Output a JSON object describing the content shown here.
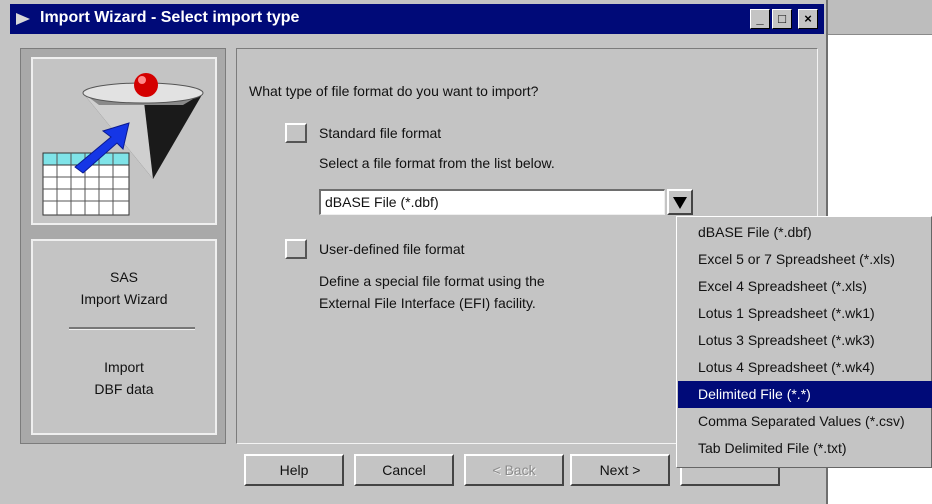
{
  "window": {
    "title": "Import Wizard - Select import type",
    "controls": {
      "minimize": "_",
      "maximize": "□",
      "close": "×"
    }
  },
  "left_panel": {
    "line1": "SAS",
    "line2": "Import Wizard",
    "line3": "Import",
    "line4": "DBF data"
  },
  "main": {
    "question": "What type of file format do you want to import?",
    "standard_label": "Standard file format",
    "standard_hint": "Select a file format from the list below.",
    "combo_value": "dBASE File (*.dbf)",
    "user_label": "User-defined file format",
    "user_desc_line1": "Define a special file format using the",
    "user_desc_line2": "External File Interface (EFI) facility."
  },
  "dropdown": {
    "items": [
      "dBASE File (*.dbf)",
      "Excel 5 or 7 Spreadsheet (*.xls)",
      "Excel 4 Spreadsheet (*.xls)",
      "Lotus 1 Spreadsheet (*.wk1)",
      "Lotus 3 Spreadsheet (*.wk3)",
      "Lotus 4 Spreadsheet (*.wk4)",
      "Delimited File (*.*)",
      "Comma Separated Values (*.csv)",
      "Tab Delimited File (*.txt)"
    ],
    "selected_index": 6
  },
  "buttons": {
    "help": "Help",
    "cancel": "Cancel",
    "back": "< Back",
    "next": "Next >"
  },
  "colors": {
    "titlebar": "#000a78",
    "selection": "#000a78",
    "face": "#c4c4c4"
  }
}
